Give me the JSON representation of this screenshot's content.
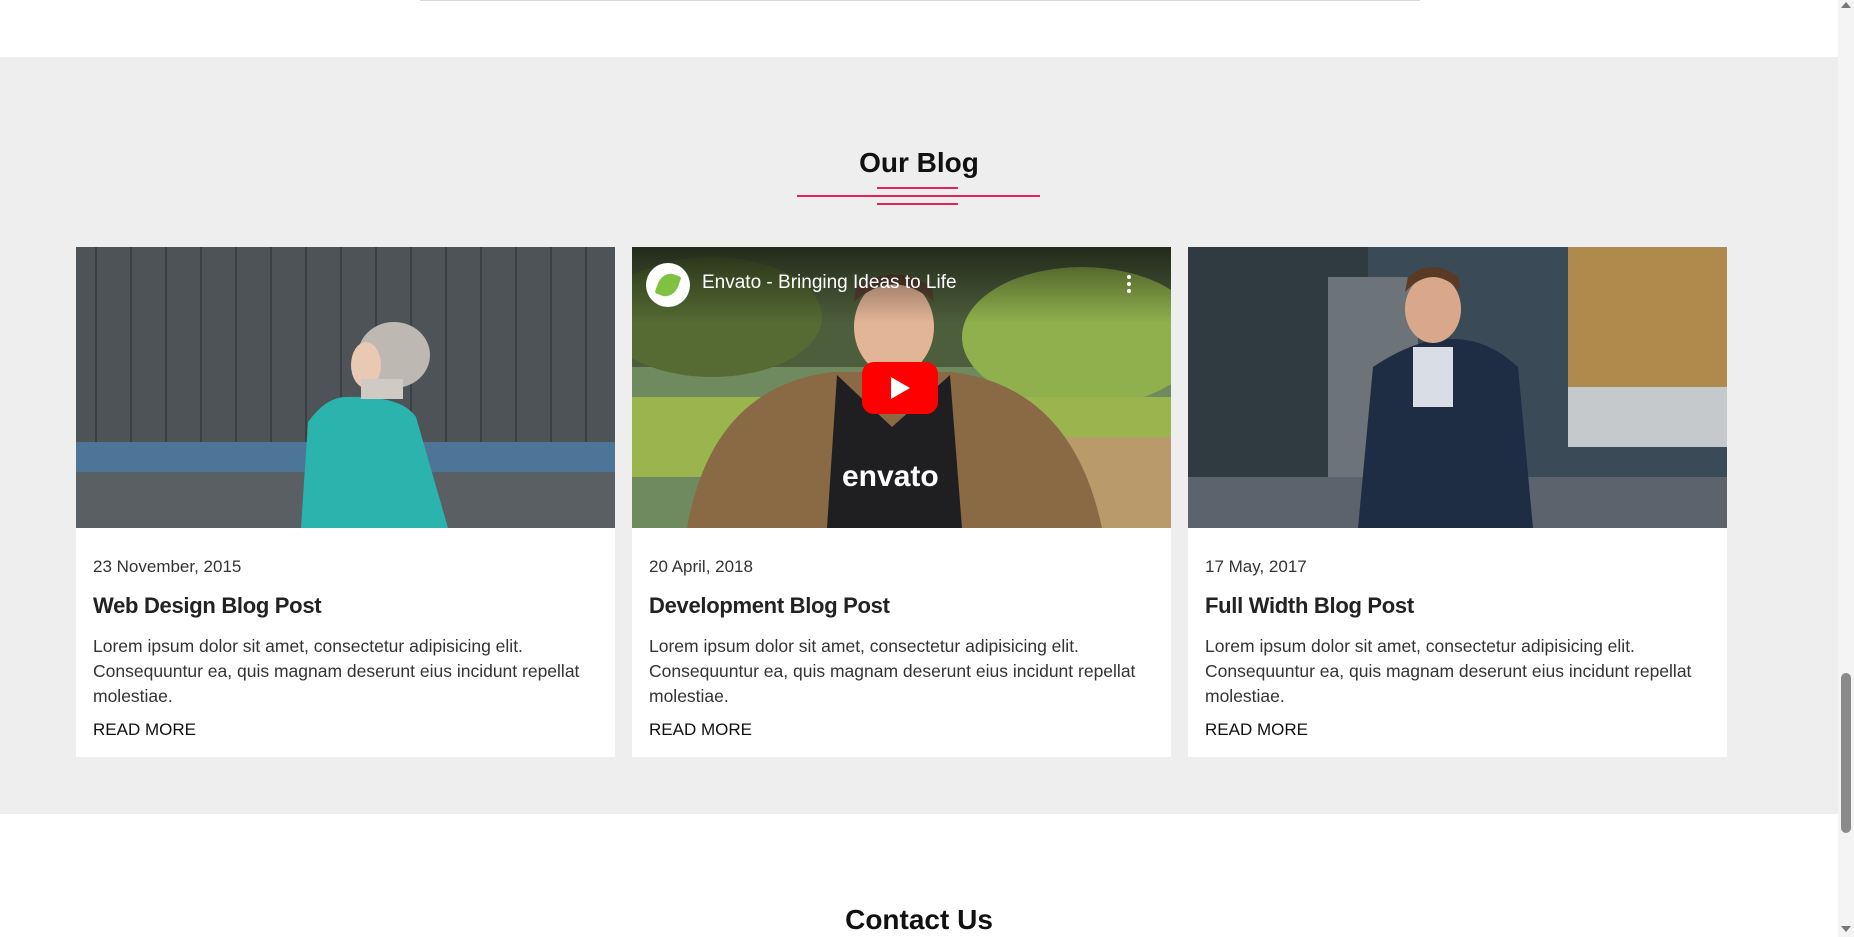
{
  "blog": {
    "heading": "Our Blog",
    "accent_color": "#e0245e",
    "posts": [
      {
        "date": "23 November, 2015",
        "title": "Web Design Blog Post",
        "excerpt": "Lorem ipsum dolor sit amet, consectetur adipisicing elit. Consequuntur ea, quis magnam deserunt eius incidunt repellat molestiae.",
        "read_more": "READ MORE",
        "media": "photo-woman-teal-jacket"
      },
      {
        "date": "20 April, 2018",
        "title": "Development Blog Post",
        "excerpt": "Lorem ipsum dolor sit amet, consectetur adipisicing elit. Consequuntur ea, quis magnam deserunt eius incidunt repellat molestiae.",
        "read_more": "READ MORE",
        "media": "youtube-video",
        "video": {
          "title": "Envato - Bringing Ideas to Life",
          "shirt_text": "envato"
        }
      },
      {
        "date": "17 May, 2017",
        "title": "Full Width Blog Post",
        "excerpt": "Lorem ipsum dolor sit amet, consectetur adipisicing elit. Consequuntur ea, quis magnam deserunt eius incidunt repellat molestiae.",
        "read_more": "READ MORE",
        "media": "photo-man-vest-street"
      }
    ]
  },
  "contact": {
    "heading": "Contact Us"
  }
}
